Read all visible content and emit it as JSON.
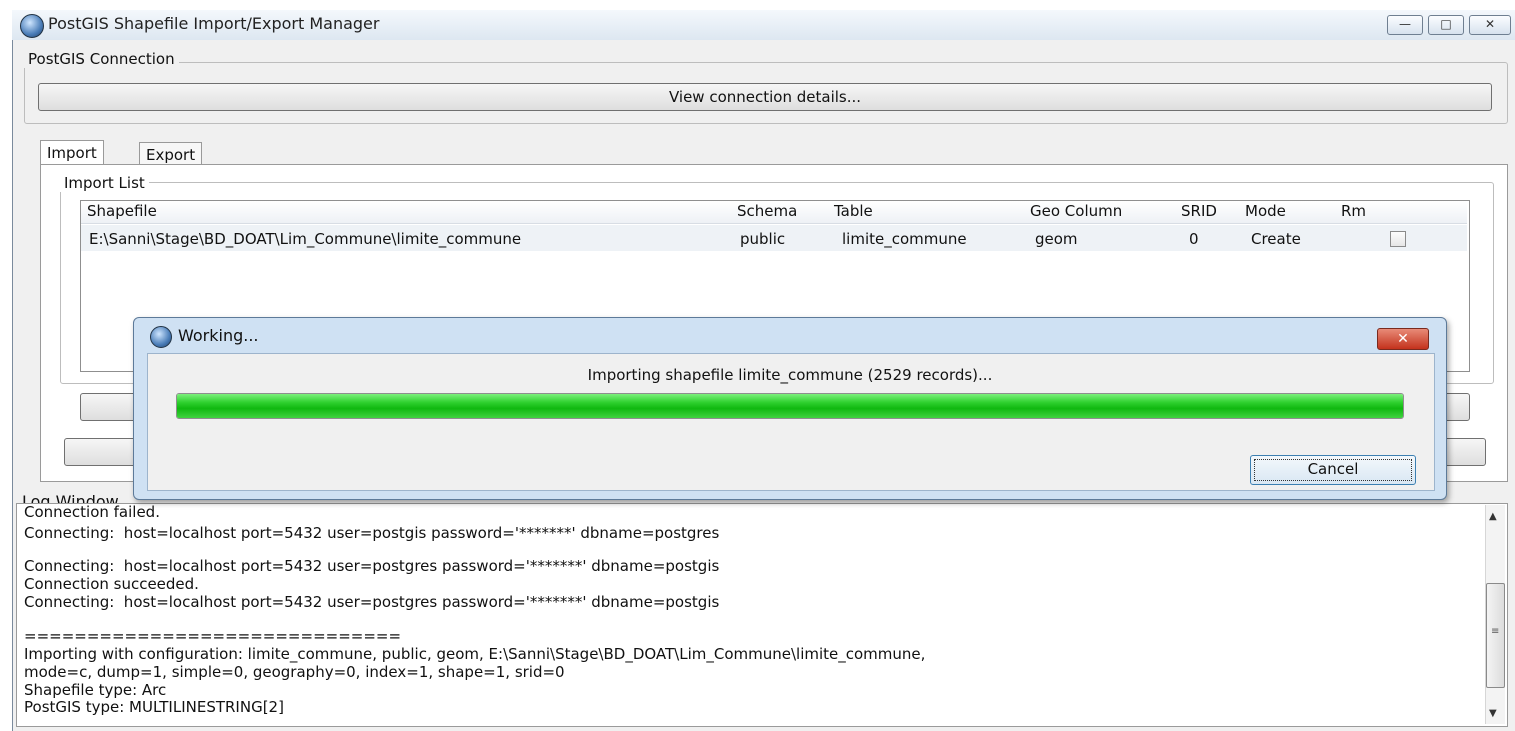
{
  "window": {
    "title": "PostGIS Shapefile Import/Export Manager",
    "min_glyph": "—",
    "max_glyph": "□",
    "close_glyph": "✕"
  },
  "connection": {
    "group_title": "PostGIS Connection",
    "view_button": "View connection details..."
  },
  "tabs": [
    {
      "label": "Import",
      "active": true
    },
    {
      "label": "Export",
      "active": false
    }
  ],
  "import_list": {
    "group_title": "Import List",
    "columns": [
      "Shapefile",
      "Schema",
      "Table",
      "Geo Column",
      "SRID",
      "Mode",
      "Rm"
    ],
    "rows": [
      {
        "shapefile": "E:\\Sanni\\Stage\\BD_DOAT\\Lim_Commune\\limite_commune",
        "schema": "public",
        "table": "limite_commune",
        "geo_column": "geom",
        "srid": "0",
        "mode": "Create",
        "rm": false
      }
    ]
  },
  "dialog": {
    "title": "Working...",
    "message": "Importing shapefile limite_commune (2529 records)...",
    "progress": 1.0,
    "cancel_label": "Cancel",
    "close_glyph": "✕"
  },
  "log": {
    "group_title": "Log Window",
    "lines": [
      "Connection failed.",
      "Connecting:  host=localhost port=5432 user=postgis password='*******' dbname=postgres",
      "",
      "Connecting:  host=localhost port=5432 user=postgres password='*******' dbname=postgis",
      "Connection succeeded.",
      "Connecting:  host=localhost port=5432 user=postgres password='*******' dbname=postgis",
      "",
      "==============================",
      "Importing with configuration: limite_commune, public, geom, E:\\Sanni\\Stage\\BD_DOAT\\Lim_Commune\\limite_commune,",
      "mode=c, dump=1, simple=0, geography=0, index=1, shape=1, srid=0",
      "Shapefile type: Arc",
      "PostGIS type: MULTILINESTRING[2]"
    ]
  },
  "colors": {
    "progress_green": "#10b810",
    "close_red": "#c3321c"
  }
}
